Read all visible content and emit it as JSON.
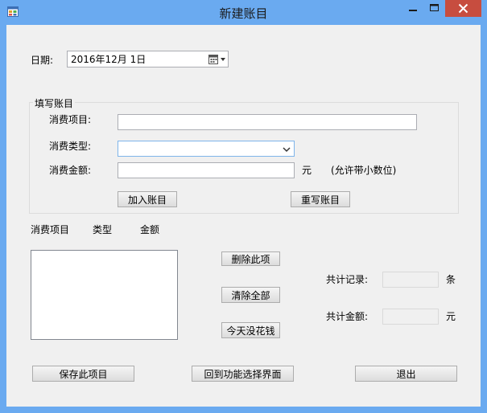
{
  "window": {
    "title": "新建账目"
  },
  "date": {
    "label": "日期:",
    "value": "2016年12月 1日"
  },
  "entry_group": {
    "title": "填写账目",
    "item_label": "消费项目:",
    "item_value": "",
    "type_label": "消费类型:",
    "type_value": "",
    "amount_label": "消费金额:",
    "amount_value": "",
    "amount_unit": "元",
    "amount_hint": "(允许带小数位)",
    "add_button": "加入账目",
    "reset_button": "重写账目"
  },
  "list": {
    "headers": [
      "消费项目",
      "类型",
      "金额"
    ],
    "items": []
  },
  "actions": {
    "delete_button": "删除此项",
    "clear_button": "清除全部",
    "no_spend_button": "今天没花钱"
  },
  "summary": {
    "records_label": "共计记录:",
    "records_value": "",
    "records_unit": "条",
    "total_label": "共计金额:",
    "total_value": "",
    "total_unit": "元"
  },
  "footer": {
    "save_button": "保存此项目",
    "back_button": "回到功能选择界面",
    "exit_button": "退出"
  }
}
